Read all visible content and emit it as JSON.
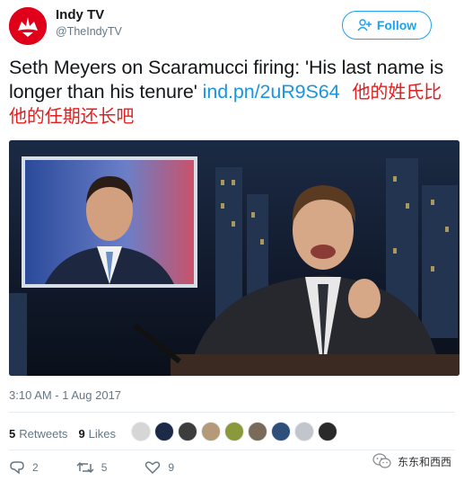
{
  "account": {
    "display_name": "Indy TV",
    "handle": "@TheIndyTV",
    "follow_label": "Follow",
    "brand_color": "#e1001a"
  },
  "tweet": {
    "text": "Seth Meyers on Scaramucci firing: 'His last name is longer than his tenure' ",
    "link": "ind.pn/2uR9S64",
    "annotation": "他的姓氏比他的任期还长吧",
    "media_icon": "tv-show-still"
  },
  "meta": {
    "timestamp": "3:10 AM - 1 Aug 2017",
    "retweets_count": "5",
    "retweets_label": "Retweets",
    "likes_count": "9",
    "likes_label": "Likes"
  },
  "actions": {
    "reply_count": "2",
    "retweet_count": "5",
    "like_count": "9"
  },
  "watermark": {
    "text": "东东和西西",
    "icon": "wechat-icon"
  },
  "colors": {
    "link": "#1b95e0",
    "accent": "#1da1f2",
    "annotation": "#e02020"
  }
}
